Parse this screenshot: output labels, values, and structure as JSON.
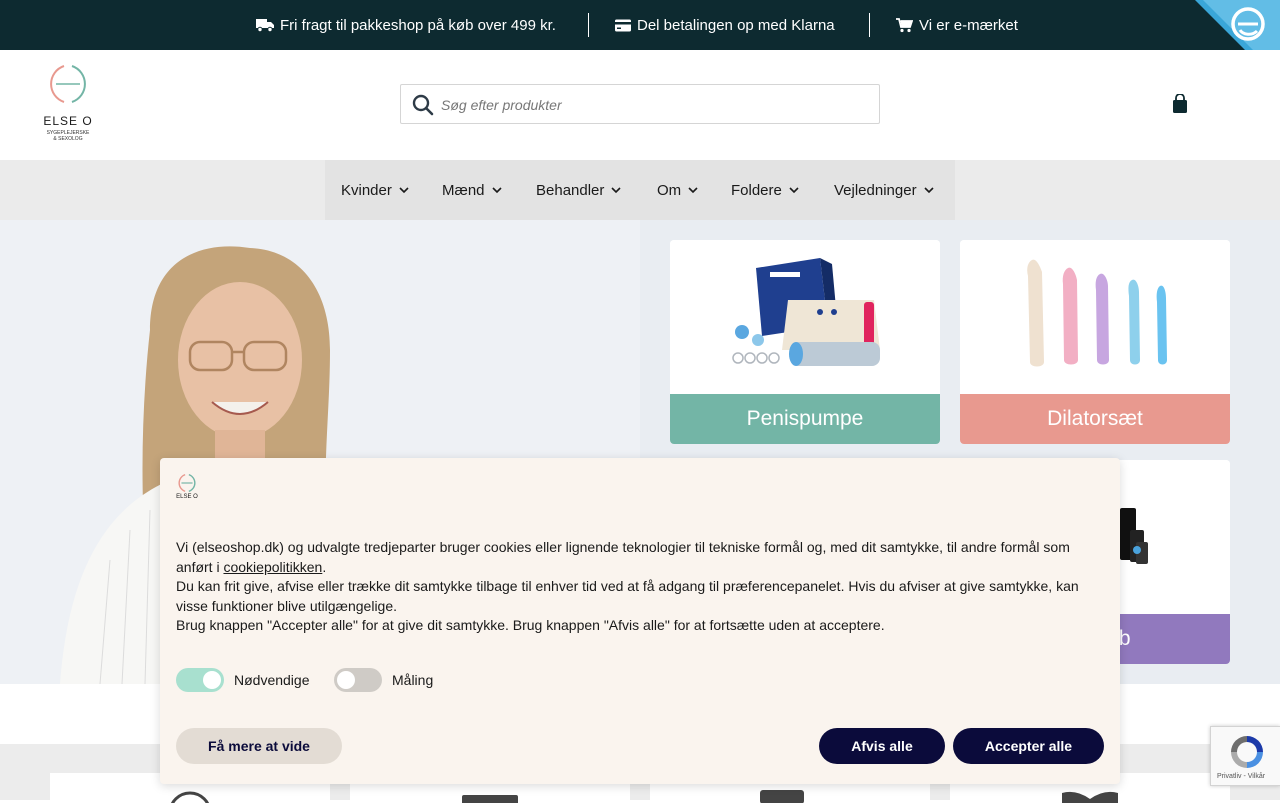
{
  "topbar": {
    "items": [
      {
        "label": "Fri fragt til pakkeshop på køb over 499 kr.",
        "icon": "truck-icon"
      },
      {
        "label": "Del betalingen op med Klarna",
        "icon": "credit-card-icon"
      },
      {
        "label": "Vi er e-mærket",
        "icon": "cart-icon"
      }
    ],
    "badge_icon": "e-maerket-badge-icon"
  },
  "header": {
    "logo_name": "ELSE O",
    "logo_subtitle_line1": "SYGEPLEJERSKE",
    "logo_subtitle_line2": "& SEXOLOG",
    "search_placeholder": "Søg efter produkter"
  },
  "nav": {
    "items": [
      {
        "label": "Kvinder"
      },
      {
        "label": "Mænd"
      },
      {
        "label": "Behandler"
      },
      {
        "label": "Om"
      },
      {
        "label": "Foldere"
      },
      {
        "label": "Vejledninger"
      }
    ]
  },
  "cards": [
    {
      "label": "Penispumpe",
      "color": "#73b5a6"
    },
    {
      "label": "Dilatorsæt",
      "color": "#e8998f"
    },
    {
      "label": "ft forløb",
      "color": "#9179be"
    }
  ],
  "cookie": {
    "logo_name": "ELSE O",
    "para1_before_link": "Vi (elseoshop.dk) og udvalgte tredjeparter bruger cookies eller lignende teknologier til tekniske formål og, med dit samtykke, til andre formål som anført i ",
    "para1_link": "cookiepolitikken",
    "para1_after_link": ".",
    "para2": "Du kan frit give, afvise eller trække dit samtykke tilbage til enhver tid ved at få adgang til præferencepanelet. Hvis du afviser at give samtykke, kan visse funktioner blive utilgængelige.",
    "para3": "Brug knappen \"Accepter alle\" for at give dit samtykke. Brug knappen \"Afvis alle\" for at fortsætte uden at acceptere.",
    "toggles": [
      {
        "label": "Nødvendige",
        "on": true
      },
      {
        "label": "Måling",
        "on": false
      }
    ],
    "learn_more": "Få mere at vide",
    "reject_all": "Afvis alle",
    "accept_all": "Accepter alle"
  },
  "recaptcha": {
    "links": "Privatliv - Vilkår"
  },
  "colors": {
    "topbar_bg": "#0d2a30",
    "button_dark": "#0b0b3b",
    "toggle_on": "#a8e0cf",
    "toggle_off": "#cfcbc6"
  }
}
